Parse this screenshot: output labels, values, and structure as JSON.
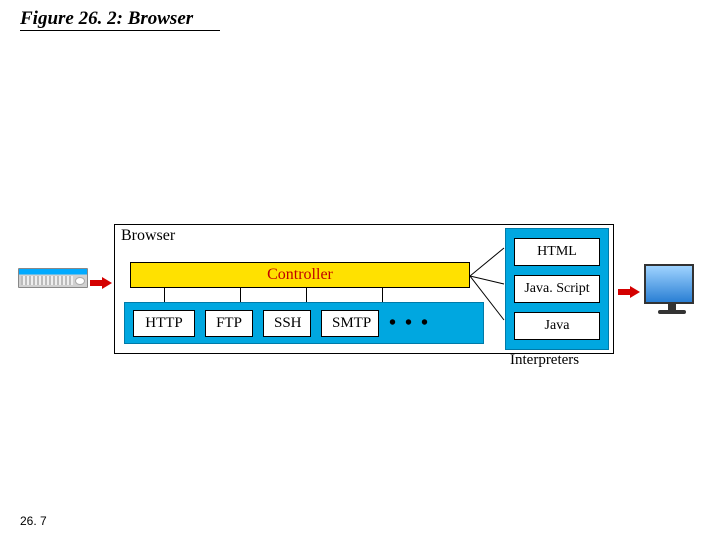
{
  "figure": {
    "number": "Figure 26. 2:",
    "title": "Browser"
  },
  "page_number": "26. 7",
  "diagram": {
    "container_label": "Browser",
    "controller_label": "Controller",
    "protocols": [
      "HTTP",
      "FTP",
      "SSH",
      "SMTP"
    ],
    "ellipsis": "• • •",
    "interpreters": [
      "HTML",
      "Java. Script",
      "Java"
    ],
    "interpreters_label": "Interpreters"
  }
}
